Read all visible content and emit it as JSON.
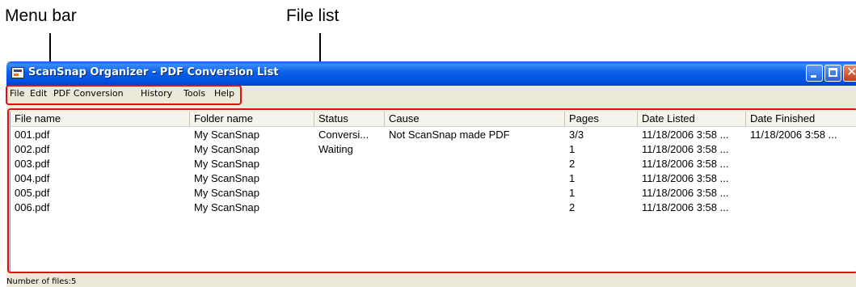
{
  "annotations": {
    "menu_bar": "Menu bar",
    "file_list": "File list"
  },
  "window": {
    "title": "ScanSnap Organizer - PDF Conversion List",
    "controls": {
      "minimize": "minimize-icon",
      "maximize": "maximize-icon",
      "close": "close-icon"
    },
    "close_glyph": "✕"
  },
  "menu": {
    "items": [
      "File",
      "Edit",
      "PDF Conversion",
      "History",
      "Tools",
      "Help"
    ]
  },
  "file_list": {
    "columns": [
      "File name",
      "Folder name",
      "Status",
      "Cause",
      "Pages",
      "Date Listed",
      "Date Finished"
    ],
    "rows": [
      [
        "001.pdf",
        "My ScanSnap",
        "Conversi...",
        "Not ScanSnap made PDF",
        "3/3",
        "11/18/2006 3:58 ...",
        "11/18/2006 3:58 ..."
      ],
      [
        "002.pdf",
        "My ScanSnap",
        "Waiting",
        "",
        "1",
        "11/18/2006 3:58 ...",
        ""
      ],
      [
        "003.pdf",
        "My ScanSnap",
        "",
        "",
        "2",
        "11/18/2006 3:58 ...",
        ""
      ],
      [
        "004.pdf",
        "My ScanSnap",
        "",
        "",
        "1",
        "11/18/2006 3:58 ...",
        ""
      ],
      [
        "005.pdf",
        "My ScanSnap",
        "",
        "",
        "1",
        "11/18/2006 3:58 ...",
        ""
      ],
      [
        "006.pdf",
        "My ScanSnap",
        "",
        "",
        "2",
        "11/18/2006 3:58 ...",
        ""
      ]
    ]
  },
  "status_bar": {
    "text": "Number of files:5"
  },
  "colors": {
    "titlebar": "#0a5fe8",
    "highlight_box": "#e01010",
    "window_face": "#ece9d8"
  }
}
